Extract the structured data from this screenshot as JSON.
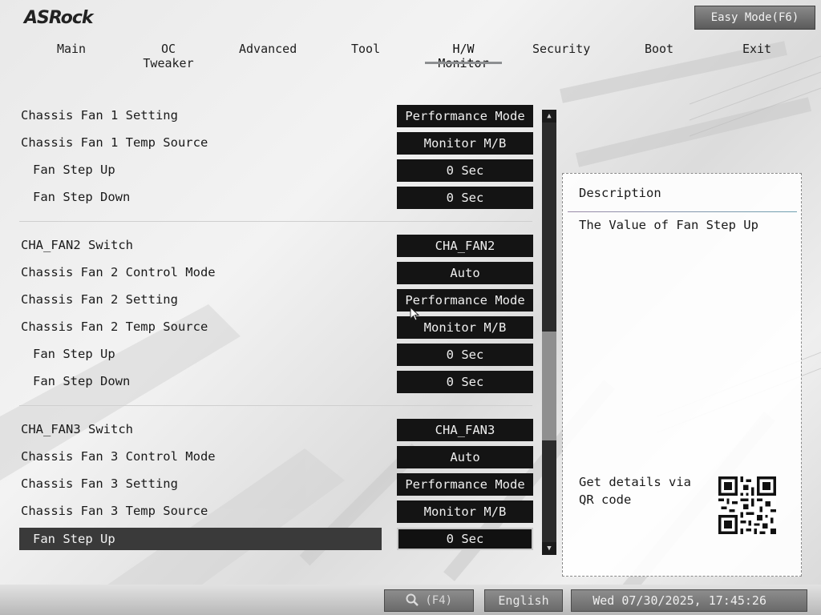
{
  "header": {
    "logo": "ASRock",
    "easy_mode": "Easy Mode(F6)"
  },
  "nav": {
    "tabs": [
      {
        "label": "Main"
      },
      {
        "label": "OC Tweaker"
      },
      {
        "label": "Advanced"
      },
      {
        "label": "Tool"
      },
      {
        "label": "H/W Monitor"
      },
      {
        "label": "Security"
      },
      {
        "label": "Boot"
      },
      {
        "label": "Exit"
      }
    ],
    "active": "H/W Monitor"
  },
  "settings": {
    "rows": [
      {
        "label": "Chassis Fan 1 Setting",
        "value": "Performance Mode"
      },
      {
        "label": "Chassis Fan 1 Temp Source",
        "value": "Monitor M/B"
      },
      {
        "label": "Fan Step Up",
        "value": "0 Sec"
      },
      {
        "label": "Fan Step Down",
        "value": "0 Sec"
      },
      {
        "label": "CHA_FAN2 Switch",
        "value": "CHA_FAN2"
      },
      {
        "label": "Chassis Fan 2 Control Mode",
        "value": "Auto"
      },
      {
        "label": "Chassis Fan 2 Setting",
        "value": "Performance Mode"
      },
      {
        "label": "Chassis Fan 2 Temp Source",
        "value": "Monitor M/B"
      },
      {
        "label": "Fan Step Up",
        "value": "0 Sec"
      },
      {
        "label": "Fan Step Down",
        "value": "0 Sec"
      },
      {
        "label": "CHA_FAN3 Switch",
        "value": "CHA_FAN3"
      },
      {
        "label": "Chassis Fan 3 Control Mode",
        "value": "Auto"
      },
      {
        "label": "Chassis Fan 3 Setting",
        "value": "Performance Mode"
      },
      {
        "label": "Chassis Fan 3 Temp Source",
        "value": "Monitor M/B"
      },
      {
        "label": "Fan Step Up",
        "value": "0 Sec"
      }
    ]
  },
  "description": {
    "title": "Description",
    "text": "The Value of Fan Step Up",
    "qr_text": "Get details via QR code"
  },
  "footer": {
    "search": "(F4)",
    "language": "English",
    "datetime": "Wed 07/30/2025, 17:45:26"
  },
  "colors": {
    "value_bg": "#141414",
    "selected_row": "#3a3a3a",
    "scroll_thumb": "#8f8f8f"
  }
}
